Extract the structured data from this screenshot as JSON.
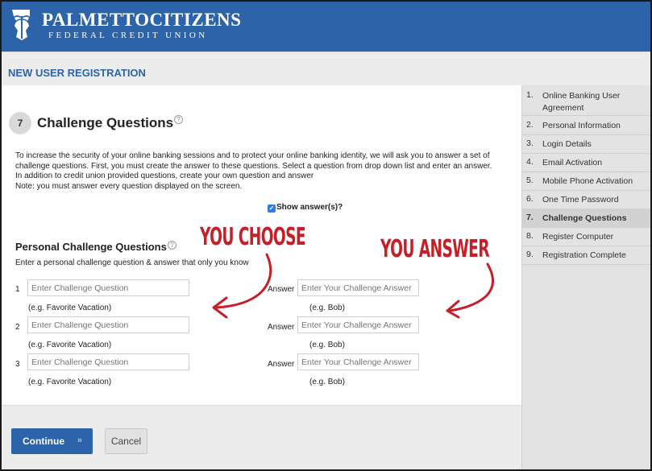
{
  "header": {
    "logo_title": "PALMETTOCITIZENS",
    "logo_subtitle": "FEDERAL CREDIT UNION"
  },
  "page": {
    "title": "NEW USER REGISTRATION"
  },
  "step": {
    "number": "7",
    "title": "Challenge Questions",
    "intro_lines": [
      "To increase the security of your online banking sessions and to protect your online banking identity, we will ask you to answer a set of",
      "challenge questions. First, you must create the answer to these questions. Select a question from drop down list and enter an answer.",
      "In addition to credit union provided questions, create your own question and answer",
      "Note: you must answer every question displayed on the screen."
    ],
    "show_answers_label": "Show answer(s)?",
    "show_answers_checked": true
  },
  "personal": {
    "title": "Personal Challenge Questions",
    "description": "Enter a personal challenge question & answer that only you know",
    "answer_label": "Answer",
    "rows": [
      {
        "num": "1",
        "question_placeholder": "Enter Challenge Question",
        "question_hint": "(e.g. Favorite Vacation)",
        "answer_placeholder": "Enter Your Challenge Answer",
        "answer_hint": "(e.g. Bob)"
      },
      {
        "num": "2",
        "question_placeholder": "Enter Challenge Question",
        "question_hint": "(e.g. Favorite Vacation)",
        "answer_placeholder": "Enter Your Challenge Answer",
        "answer_hint": "(e.g. Bob)"
      },
      {
        "num": "3",
        "question_placeholder": "Enter Challenge Question",
        "question_hint": "(e.g. Favorite Vacation)",
        "answer_placeholder": "Enter Your Challenge Answer",
        "answer_hint": "(e.g. Bob)"
      }
    ]
  },
  "annotations": {
    "choose": "YOU CHOOSE",
    "answer": "YOU ANSWER",
    "color": "#c61f27"
  },
  "sidebar": {
    "items": [
      {
        "num": "1.",
        "label": "Online Banking User Agreement",
        "active": false
      },
      {
        "num": "2.",
        "label": "Personal Information",
        "active": false
      },
      {
        "num": "3.",
        "label": "Login Details",
        "active": false
      },
      {
        "num": "4.",
        "label": "Email Activation",
        "active": false
      },
      {
        "num": "5.",
        "label": "Mobile Phone Activation",
        "active": false
      },
      {
        "num": "6.",
        "label": "One Time Password",
        "active": false
      },
      {
        "num": "7.",
        "label": "Challenge Questions",
        "active": true
      },
      {
        "num": "8.",
        "label": "Register Computer",
        "active": false
      },
      {
        "num": "9.",
        "label": "Registration Complete",
        "active": false
      }
    ]
  },
  "footer": {
    "continue_label": "Continue",
    "continue_icon": "double-chevron-right-icon",
    "cancel_label": "Cancel"
  },
  "colors": {
    "brand_blue": "#2d63a8",
    "checkbox_blue": "#2f7de0"
  }
}
